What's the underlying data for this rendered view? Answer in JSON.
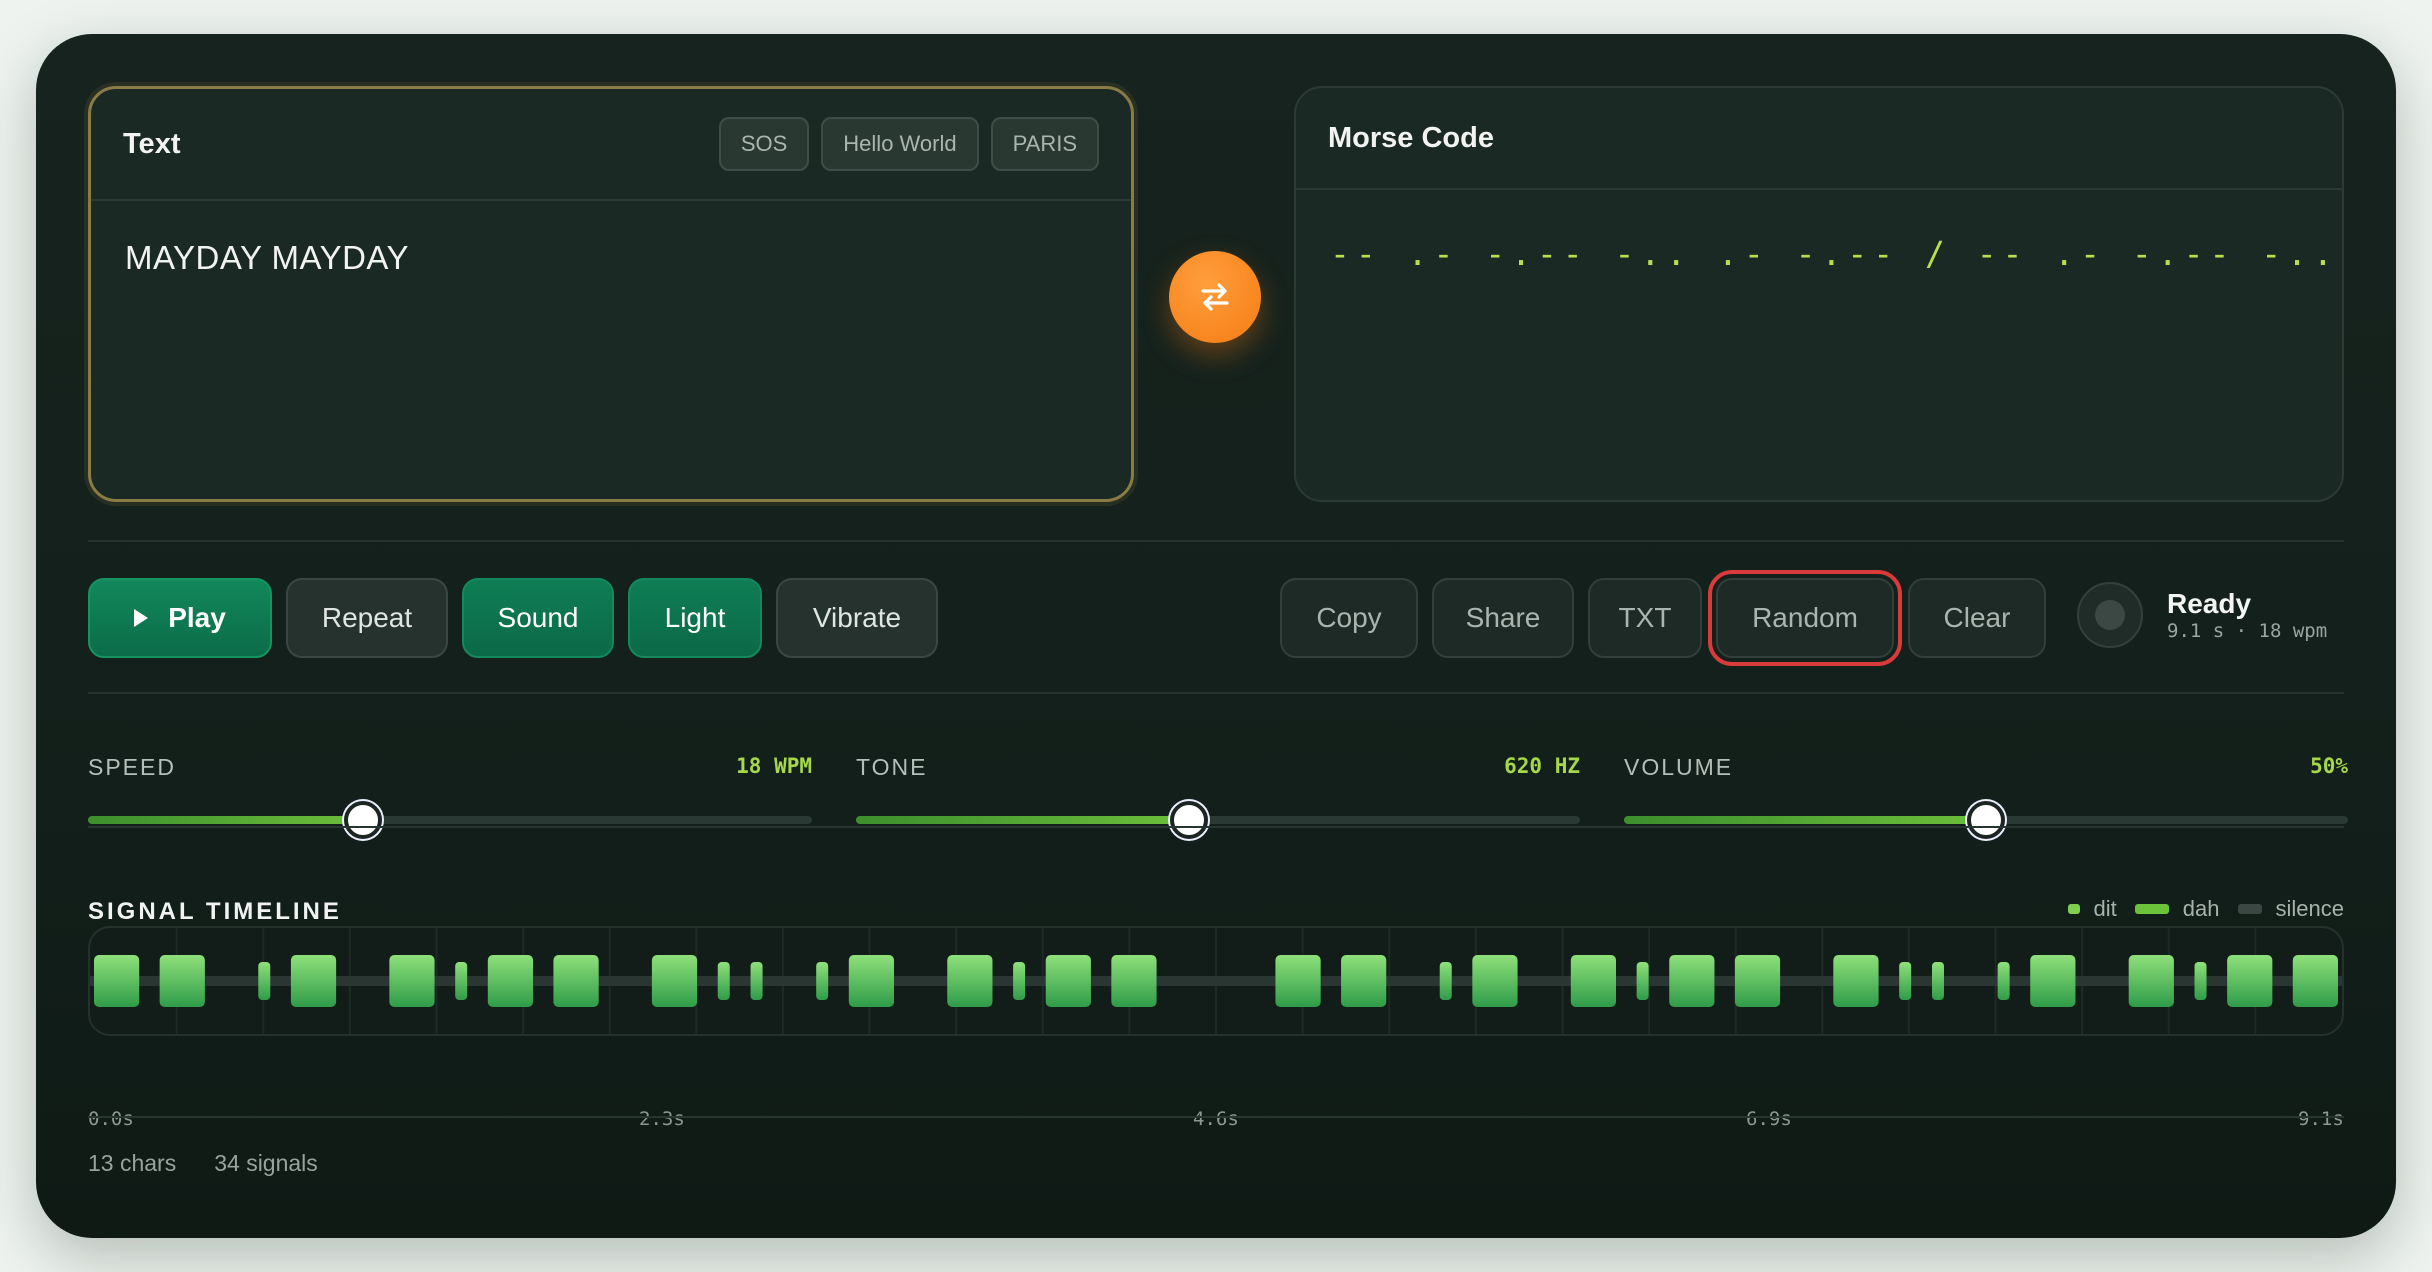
{
  "text_panel": {
    "title": "Text",
    "presets": [
      "SOS",
      "Hello World",
      "PARIS"
    ],
    "value": "MAYDAY MAYDAY"
  },
  "morse_panel": {
    "title": "Morse Code",
    "value": "-- .- -.-- -.. .- -.-- / -- .- -.-- -.. .- -.--"
  },
  "swap_icon": "swap-arrows-icon",
  "controls": {
    "play": "Play",
    "repeat": "Repeat",
    "sound": "Sound",
    "light": "Light",
    "vibrate": "Vibrate",
    "copy": "Copy",
    "share": "Share",
    "txt": "TXT",
    "random": "Random",
    "clear": "Clear"
  },
  "status": {
    "title": "Ready",
    "detail": "9.1 s · 18 wpm"
  },
  "sliders": [
    {
      "label": "SPEED",
      "value": "18 WPM",
      "level": 0.38
    },
    {
      "label": "TONE",
      "value": "620 HZ",
      "level": 0.46
    },
    {
      "label": "VOLUME",
      "value": "50%",
      "level": 0.5
    }
  ],
  "timeline": {
    "title": "SIGNAL TIMELINE",
    "legend": [
      "dit",
      "dah",
      "silence"
    ],
    "ticks": [
      "0.0s",
      "2.3s",
      "4.6s",
      "6.9s",
      "9.1s"
    ],
    "signals": "-- .- -.-- -.. .- -.-- / -- .- -.-- -.. .- -.--"
  },
  "footer": {
    "chars": "13 chars",
    "signals": "34 signals"
  },
  "colors": {
    "accent_orange": "#f57c12",
    "signal_green": "#5cc46a",
    "morse_text": "#b8e04e",
    "selection_red": "#d93a3a"
  }
}
